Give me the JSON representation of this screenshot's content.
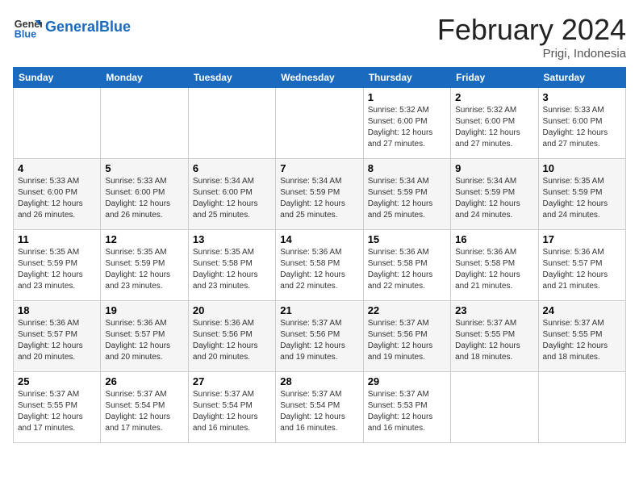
{
  "header": {
    "logo_text_general": "General",
    "logo_text_blue": "Blue",
    "title": "February 2024",
    "subtitle": "Prigi, Indonesia"
  },
  "days_of_week": [
    "Sunday",
    "Monday",
    "Tuesday",
    "Wednesday",
    "Thursday",
    "Friday",
    "Saturday"
  ],
  "weeks": [
    [
      {
        "day": "",
        "info": ""
      },
      {
        "day": "",
        "info": ""
      },
      {
        "day": "",
        "info": ""
      },
      {
        "day": "",
        "info": ""
      },
      {
        "day": "1",
        "info": "Sunrise: 5:32 AM\nSunset: 6:00 PM\nDaylight: 12 hours\nand 27 minutes."
      },
      {
        "day": "2",
        "info": "Sunrise: 5:32 AM\nSunset: 6:00 PM\nDaylight: 12 hours\nand 27 minutes."
      },
      {
        "day": "3",
        "info": "Sunrise: 5:33 AM\nSunset: 6:00 PM\nDaylight: 12 hours\nand 27 minutes."
      }
    ],
    [
      {
        "day": "4",
        "info": "Sunrise: 5:33 AM\nSunset: 6:00 PM\nDaylight: 12 hours\nand 26 minutes."
      },
      {
        "day": "5",
        "info": "Sunrise: 5:33 AM\nSunset: 6:00 PM\nDaylight: 12 hours\nand 26 minutes."
      },
      {
        "day": "6",
        "info": "Sunrise: 5:34 AM\nSunset: 6:00 PM\nDaylight: 12 hours\nand 25 minutes."
      },
      {
        "day": "7",
        "info": "Sunrise: 5:34 AM\nSunset: 5:59 PM\nDaylight: 12 hours\nand 25 minutes."
      },
      {
        "day": "8",
        "info": "Sunrise: 5:34 AM\nSunset: 5:59 PM\nDaylight: 12 hours\nand 25 minutes."
      },
      {
        "day": "9",
        "info": "Sunrise: 5:34 AM\nSunset: 5:59 PM\nDaylight: 12 hours\nand 24 minutes."
      },
      {
        "day": "10",
        "info": "Sunrise: 5:35 AM\nSunset: 5:59 PM\nDaylight: 12 hours\nand 24 minutes."
      }
    ],
    [
      {
        "day": "11",
        "info": "Sunrise: 5:35 AM\nSunset: 5:59 PM\nDaylight: 12 hours\nand 23 minutes."
      },
      {
        "day": "12",
        "info": "Sunrise: 5:35 AM\nSunset: 5:59 PM\nDaylight: 12 hours\nand 23 minutes."
      },
      {
        "day": "13",
        "info": "Sunrise: 5:35 AM\nSunset: 5:58 PM\nDaylight: 12 hours\nand 23 minutes."
      },
      {
        "day": "14",
        "info": "Sunrise: 5:36 AM\nSunset: 5:58 PM\nDaylight: 12 hours\nand 22 minutes."
      },
      {
        "day": "15",
        "info": "Sunrise: 5:36 AM\nSunset: 5:58 PM\nDaylight: 12 hours\nand 22 minutes."
      },
      {
        "day": "16",
        "info": "Sunrise: 5:36 AM\nSunset: 5:58 PM\nDaylight: 12 hours\nand 21 minutes."
      },
      {
        "day": "17",
        "info": "Sunrise: 5:36 AM\nSunset: 5:57 PM\nDaylight: 12 hours\nand 21 minutes."
      }
    ],
    [
      {
        "day": "18",
        "info": "Sunrise: 5:36 AM\nSunset: 5:57 PM\nDaylight: 12 hours\nand 20 minutes."
      },
      {
        "day": "19",
        "info": "Sunrise: 5:36 AM\nSunset: 5:57 PM\nDaylight: 12 hours\nand 20 minutes."
      },
      {
        "day": "20",
        "info": "Sunrise: 5:36 AM\nSunset: 5:56 PM\nDaylight: 12 hours\nand 20 minutes."
      },
      {
        "day": "21",
        "info": "Sunrise: 5:37 AM\nSunset: 5:56 PM\nDaylight: 12 hours\nand 19 minutes."
      },
      {
        "day": "22",
        "info": "Sunrise: 5:37 AM\nSunset: 5:56 PM\nDaylight: 12 hours\nand 19 minutes."
      },
      {
        "day": "23",
        "info": "Sunrise: 5:37 AM\nSunset: 5:55 PM\nDaylight: 12 hours\nand 18 minutes."
      },
      {
        "day": "24",
        "info": "Sunrise: 5:37 AM\nSunset: 5:55 PM\nDaylight: 12 hours\nand 18 minutes."
      }
    ],
    [
      {
        "day": "25",
        "info": "Sunrise: 5:37 AM\nSunset: 5:55 PM\nDaylight: 12 hours\nand 17 minutes."
      },
      {
        "day": "26",
        "info": "Sunrise: 5:37 AM\nSunset: 5:54 PM\nDaylight: 12 hours\nand 17 minutes."
      },
      {
        "day": "27",
        "info": "Sunrise: 5:37 AM\nSunset: 5:54 PM\nDaylight: 12 hours\nand 16 minutes."
      },
      {
        "day": "28",
        "info": "Sunrise: 5:37 AM\nSunset: 5:54 PM\nDaylight: 12 hours\nand 16 minutes."
      },
      {
        "day": "29",
        "info": "Sunrise: 5:37 AM\nSunset: 5:53 PM\nDaylight: 12 hours\nand 16 minutes."
      },
      {
        "day": "",
        "info": ""
      },
      {
        "day": "",
        "info": ""
      }
    ]
  ]
}
